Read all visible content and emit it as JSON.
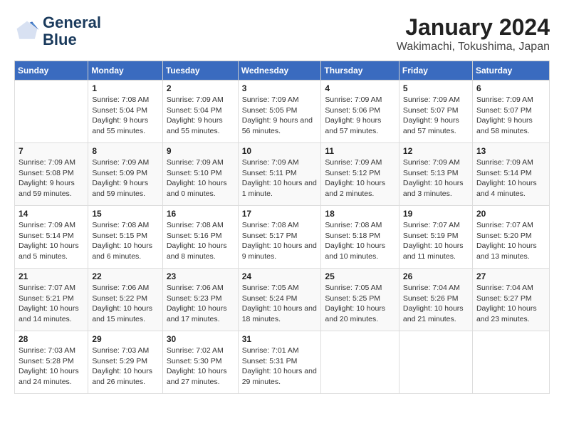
{
  "header": {
    "logo_line1": "General",
    "logo_line2": "Blue",
    "title": "January 2024",
    "subtitle": "Wakimachi, Tokushima, Japan"
  },
  "weekdays": [
    "Sunday",
    "Monday",
    "Tuesday",
    "Wednesday",
    "Thursday",
    "Friday",
    "Saturday"
  ],
  "weeks": [
    [
      {
        "day": "",
        "sunrise": "",
        "sunset": "",
        "daylight": ""
      },
      {
        "day": "1",
        "sunrise": "7:08 AM",
        "sunset": "5:04 PM",
        "daylight": "9 hours and 55 minutes."
      },
      {
        "day": "2",
        "sunrise": "7:09 AM",
        "sunset": "5:04 PM",
        "daylight": "9 hours and 55 minutes."
      },
      {
        "day": "3",
        "sunrise": "7:09 AM",
        "sunset": "5:05 PM",
        "daylight": "9 hours and 56 minutes."
      },
      {
        "day": "4",
        "sunrise": "7:09 AM",
        "sunset": "5:06 PM",
        "daylight": "9 hours and 57 minutes."
      },
      {
        "day": "5",
        "sunrise": "7:09 AM",
        "sunset": "5:07 PM",
        "daylight": "9 hours and 57 minutes."
      },
      {
        "day": "6",
        "sunrise": "7:09 AM",
        "sunset": "5:07 PM",
        "daylight": "9 hours and 58 minutes."
      }
    ],
    [
      {
        "day": "7",
        "sunrise": "7:09 AM",
        "sunset": "5:08 PM",
        "daylight": "9 hours and 59 minutes."
      },
      {
        "day": "8",
        "sunrise": "7:09 AM",
        "sunset": "5:09 PM",
        "daylight": "9 hours and 59 minutes."
      },
      {
        "day": "9",
        "sunrise": "7:09 AM",
        "sunset": "5:10 PM",
        "daylight": "10 hours and 0 minutes."
      },
      {
        "day": "10",
        "sunrise": "7:09 AM",
        "sunset": "5:11 PM",
        "daylight": "10 hours and 1 minute."
      },
      {
        "day": "11",
        "sunrise": "7:09 AM",
        "sunset": "5:12 PM",
        "daylight": "10 hours and 2 minutes."
      },
      {
        "day": "12",
        "sunrise": "7:09 AM",
        "sunset": "5:13 PM",
        "daylight": "10 hours and 3 minutes."
      },
      {
        "day": "13",
        "sunrise": "7:09 AM",
        "sunset": "5:14 PM",
        "daylight": "10 hours and 4 minutes."
      }
    ],
    [
      {
        "day": "14",
        "sunrise": "7:09 AM",
        "sunset": "5:14 PM",
        "daylight": "10 hours and 5 minutes."
      },
      {
        "day": "15",
        "sunrise": "7:08 AM",
        "sunset": "5:15 PM",
        "daylight": "10 hours and 6 minutes."
      },
      {
        "day": "16",
        "sunrise": "7:08 AM",
        "sunset": "5:16 PM",
        "daylight": "10 hours and 8 minutes."
      },
      {
        "day": "17",
        "sunrise": "7:08 AM",
        "sunset": "5:17 PM",
        "daylight": "10 hours and 9 minutes."
      },
      {
        "day": "18",
        "sunrise": "7:08 AM",
        "sunset": "5:18 PM",
        "daylight": "10 hours and 10 minutes."
      },
      {
        "day": "19",
        "sunrise": "7:07 AM",
        "sunset": "5:19 PM",
        "daylight": "10 hours and 11 minutes."
      },
      {
        "day": "20",
        "sunrise": "7:07 AM",
        "sunset": "5:20 PM",
        "daylight": "10 hours and 13 minutes."
      }
    ],
    [
      {
        "day": "21",
        "sunrise": "7:07 AM",
        "sunset": "5:21 PM",
        "daylight": "10 hours and 14 minutes."
      },
      {
        "day": "22",
        "sunrise": "7:06 AM",
        "sunset": "5:22 PM",
        "daylight": "10 hours and 15 minutes."
      },
      {
        "day": "23",
        "sunrise": "7:06 AM",
        "sunset": "5:23 PM",
        "daylight": "10 hours and 17 minutes."
      },
      {
        "day": "24",
        "sunrise": "7:05 AM",
        "sunset": "5:24 PM",
        "daylight": "10 hours and 18 minutes."
      },
      {
        "day": "25",
        "sunrise": "7:05 AM",
        "sunset": "5:25 PM",
        "daylight": "10 hours and 20 minutes."
      },
      {
        "day": "26",
        "sunrise": "7:04 AM",
        "sunset": "5:26 PM",
        "daylight": "10 hours and 21 minutes."
      },
      {
        "day": "27",
        "sunrise": "7:04 AM",
        "sunset": "5:27 PM",
        "daylight": "10 hours and 23 minutes."
      }
    ],
    [
      {
        "day": "28",
        "sunrise": "7:03 AM",
        "sunset": "5:28 PM",
        "daylight": "10 hours and 24 minutes."
      },
      {
        "day": "29",
        "sunrise": "7:03 AM",
        "sunset": "5:29 PM",
        "daylight": "10 hours and 26 minutes."
      },
      {
        "day": "30",
        "sunrise": "7:02 AM",
        "sunset": "5:30 PM",
        "daylight": "10 hours and 27 minutes."
      },
      {
        "day": "31",
        "sunrise": "7:01 AM",
        "sunset": "5:31 PM",
        "daylight": "10 hours and 29 minutes."
      },
      {
        "day": "",
        "sunrise": "",
        "sunset": "",
        "daylight": ""
      },
      {
        "day": "",
        "sunrise": "",
        "sunset": "",
        "daylight": ""
      },
      {
        "day": "",
        "sunrise": "",
        "sunset": "",
        "daylight": ""
      }
    ]
  ]
}
